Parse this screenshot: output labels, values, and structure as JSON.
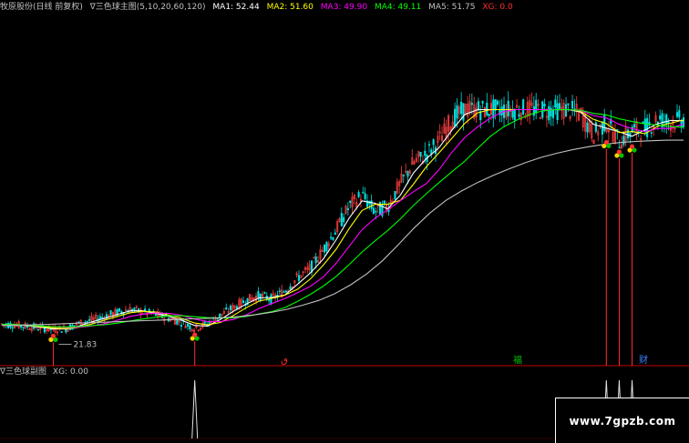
{
  "header": {
    "stock": "牧原股份(日线 前复权)",
    "indicator": "∇三色球主图(5,10,20,60,120)",
    "ma1_label": "MA1: 52.44",
    "ma2_label": "MA2: 51.60",
    "ma3_label": "MA3: 49.90",
    "ma4_label": "MA4: 49.11",
    "ma5_label": "MA5: 51.75",
    "xg_label": "XG: 0.0",
    "colors": {
      "stock": "#c0c0c0",
      "indicator": "#c0c0c0",
      "ma1": "#ffffff",
      "ma2": "#ffff00",
      "ma3": "#ff00ff",
      "ma4": "#00ff00",
      "ma5": "#c0c0c0",
      "xg": "#ff3030"
    }
  },
  "sub_header": {
    "indicator": "∇三色球副图",
    "xg_label": "XG: 0.00"
  },
  "watermark": {
    "text": "www.7gpzb.com"
  },
  "chart_data": {
    "type": "line",
    "y_unit": "price",
    "ma_names": [
      "MA1",
      "MA2",
      "MA3",
      "MA4",
      "MA5"
    ],
    "ma_colors": [
      "#ffffff",
      "#ffff00",
      "#ff00ff",
      "#00ff00",
      "#c0c0c0"
    ],
    "price_series": [
      22.8,
      22.7,
      22.4,
      22.2,
      21.9,
      22.1,
      22.9,
      23.5,
      24.1,
      24.8,
      25.3,
      24.8,
      24.4,
      23.8,
      23.1,
      22.1,
      22.9,
      24.3,
      25.6,
      26.8,
      27.6,
      27.0,
      28.4,
      30.6,
      32.2,
      35.3,
      38.6,
      42.5,
      44.4,
      41.7,
      42.5,
      46.4,
      49.8,
      51.2,
      53.5,
      57.1,
      58.7,
      58.7,
      58.7,
      58.7,
      58.7,
      58.7,
      58.7,
      58.7,
      58.7,
      57.9,
      54.6,
      56.6,
      53.4,
      55.1,
      55.5,
      57.2,
      56.6,
      57.1
    ],
    "ma5_series": [
      22.6,
      22.6,
      22.7,
      22.8,
      22.9,
      23.0,
      23.1,
      23.2,
      23.3,
      23.4,
      23.5,
      23.6,
      23.7,
      23.8,
      23.9,
      24.1,
      24.4,
      24.8,
      25.3,
      26.0,
      26.8,
      27.9,
      29.4,
      31.2,
      33.4,
      36.1,
      38.9,
      41.4,
      43.5,
      45.1,
      46.5,
      47.7,
      48.8,
      49.8,
      50.7,
      51.4,
      52.0,
      52.5,
      52.9,
      53.2,
      53.4,
      53.5,
      53.6,
      53.6
    ],
    "ma_labels_in_chart": [
      "21.83"
    ],
    "signal_markers": [
      {
        "type": "tri-ball",
        "value": 21.9,
        "label": "21.83"
      },
      {
        "type": "tri-ball",
        "value": 22.1
      },
      {
        "type": "tri-ball",
        "value": 54.3
      },
      {
        "type": "tri-ball",
        "value": 52.7
      },
      {
        "type": "tri-ball",
        "value": 53.6
      }
    ],
    "xg_values": [
      0,
      1,
      1,
      1,
      1
    ],
    "bottom_labels": [
      {
        "text": "福",
        "color": "#00c000"
      },
      {
        "text": "财",
        "color": "#4080ff"
      },
      {
        "text": "ٯ",
        "color": "#ff3030"
      }
    ],
    "grid": false
  }
}
